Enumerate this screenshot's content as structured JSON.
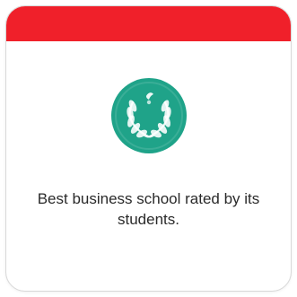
{
  "card": {
    "accent_color": "#f0202a",
    "badge_color": "#1fa389",
    "badge_icon": "laurel-wreath-icon",
    "description": "Best business school rated by its students."
  }
}
